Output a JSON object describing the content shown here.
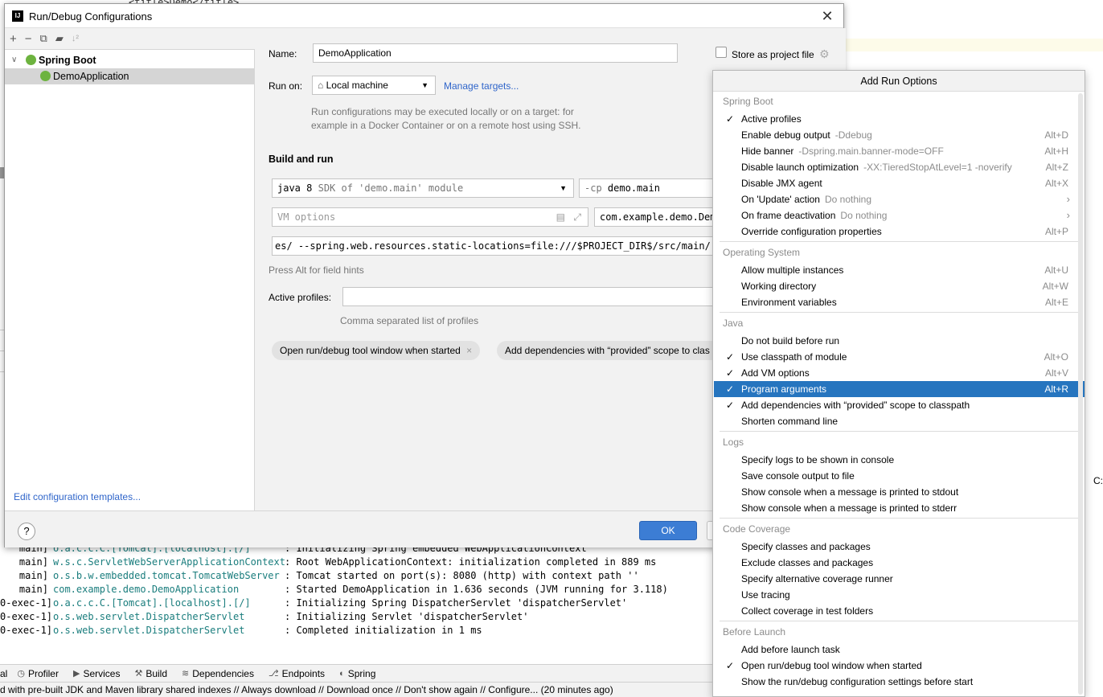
{
  "background": {
    "code_fragment": "<title>Demo</title>",
    "console_lines": [
      {
        "thread": "main]",
        "cls": "o.a.c.c.C.[Tomcat].[localhost].[/]",
        "msg": ": Initializing Spring embedded WebApplicationContext"
      },
      {
        "thread": "main]",
        "cls": "w.s.c.ServletWebServerApplicationContext",
        "msg": ": Root WebApplicationContext: initialization completed in 889 ms"
      },
      {
        "thread": "main]",
        "cls": "o.s.b.w.embedded.tomcat.TomcatWebServer",
        "msg": ": Tomcat started on port(s): 8080 (http) with context path ''"
      },
      {
        "thread": "main]",
        "cls": "com.example.demo.DemoApplication",
        "msg": ": Started DemoApplication in 1.636 seconds (JVM running for 3.118)"
      },
      {
        "thread": "0-exec-1]",
        "cls": "o.a.c.c.C.[Tomcat].[localhost].[/]",
        "msg": ": Initializing Spring DispatcherServlet 'dispatcherServlet'"
      },
      {
        "thread": "0-exec-1]",
        "cls": "o.s.web.servlet.DispatcherServlet",
        "msg": ": Initializing Servlet 'dispatcherServlet'"
      },
      {
        "thread": "0-exec-1]",
        "cls": "o.s.web.servlet.DispatcherServlet",
        "msg": ": Completed initialization in 1 ms"
      }
    ],
    "toolbar": [
      "al",
      "Profiler",
      "Services",
      "Build",
      "Dependencies",
      "Endpoints",
      "Spring"
    ],
    "status": "d with pre-built JDK and Maven library shared indexes // Always download // Download once // Don't show again // Configure... (20 minutes ago)",
    "edge_char": "C:"
  },
  "dialog": {
    "title": "Run/Debug Configurations",
    "tree": {
      "group": "Spring Boot",
      "item": "DemoApplication"
    },
    "edit_templates": "Edit configuration templates...",
    "name_label": "Name:",
    "name_value": "DemoApplication",
    "store_label": "Store as project file",
    "run_on_label": "Run on:",
    "run_on_value": "Local machine",
    "manage_targets": "Manage targets...",
    "run_on_hint_1": "Run configurations may be executed locally or on a target: for",
    "run_on_hint_2": "example in a Docker Container or on a remote host using SSH.",
    "build_run": "Build and run",
    "jdk_main": "java 8",
    "jdk_hint": "SDK of 'demo.main' module",
    "cp_label": "-cp",
    "cp_value": "demo.main",
    "vm_placeholder": "VM options",
    "main_class": "com.example.demo.Demo",
    "program_args": "es/ --spring.web.resources.static-locations=file:///$PROJECT_DIR$/src/main/res",
    "field_hint": "Press Alt for field hints",
    "active_profiles_label": "Active profiles:",
    "profiles_hint": "Comma separated list of profiles",
    "chip1": "Open run/debug tool window when started",
    "chip2": "Add dependencies with “provided” scope to clas",
    "ok": "OK",
    "help": "?"
  },
  "popup": {
    "title": "Add Run Options",
    "sections": [
      {
        "name": "Spring Boot",
        "items": [
          {
            "label": "Active profiles",
            "checked": true
          },
          {
            "label": "Enable debug output",
            "hint": "-Ddebug",
            "shortcut": "Alt+D"
          },
          {
            "label": "Hide banner",
            "hint": "-Dspring.main.banner-mode=OFF",
            "shortcut": "Alt+H"
          },
          {
            "label": "Disable launch optimization",
            "hint": "-XX:TieredStopAtLevel=1 -noverify",
            "shortcut": "Alt+Z"
          },
          {
            "label": "Disable JMX agent",
            "shortcut": "Alt+X"
          },
          {
            "label": "On 'Update' action",
            "hint": "Do nothing",
            "submenu": true
          },
          {
            "label": "On frame deactivation",
            "hint": "Do nothing",
            "submenu": true
          },
          {
            "label": "Override configuration properties",
            "shortcut": "Alt+P"
          }
        ]
      },
      {
        "name": "Operating System",
        "items": [
          {
            "label": "Allow multiple instances",
            "shortcut": "Alt+U"
          },
          {
            "label": "Working directory",
            "shortcut": "Alt+W"
          },
          {
            "label": "Environment variables",
            "shortcut": "Alt+E"
          }
        ]
      },
      {
        "name": "Java",
        "items": [
          {
            "label": "Do not build before run"
          },
          {
            "label": "Use classpath of module",
            "checked": true,
            "shortcut": "Alt+O"
          },
          {
            "label": "Add VM options",
            "checked": true,
            "shortcut": "Alt+V"
          },
          {
            "label": "Program arguments",
            "checked": true,
            "shortcut": "Alt+R",
            "selected": true
          },
          {
            "label": "Add dependencies with “provided” scope to classpath",
            "checked": true
          },
          {
            "label": "Shorten command line"
          }
        ]
      },
      {
        "name": "Logs",
        "items": [
          {
            "label": "Specify logs to be shown in console"
          },
          {
            "label": "Save console output to file"
          },
          {
            "label": "Show console when a message is printed to stdout"
          },
          {
            "label": "Show console when a message is printed to stderr"
          }
        ]
      },
      {
        "name": "Code Coverage",
        "items": [
          {
            "label": "Specify classes and packages"
          },
          {
            "label": "Exclude classes and packages"
          },
          {
            "label": "Specify alternative coverage runner"
          },
          {
            "label": "Use tracing"
          },
          {
            "label": "Collect coverage in test folders"
          }
        ]
      },
      {
        "name": "Before Launch",
        "items": [
          {
            "label": "Add before launch task"
          },
          {
            "label": "Open run/debug tool window when started",
            "checked": true
          },
          {
            "label": "Show the run/debug configuration settings before start"
          }
        ]
      }
    ]
  },
  "colors": {
    "accent": "#2675bf",
    "link": "#2f65ca",
    "spring": "#6db33f",
    "console_class": "#1a7d7d"
  }
}
